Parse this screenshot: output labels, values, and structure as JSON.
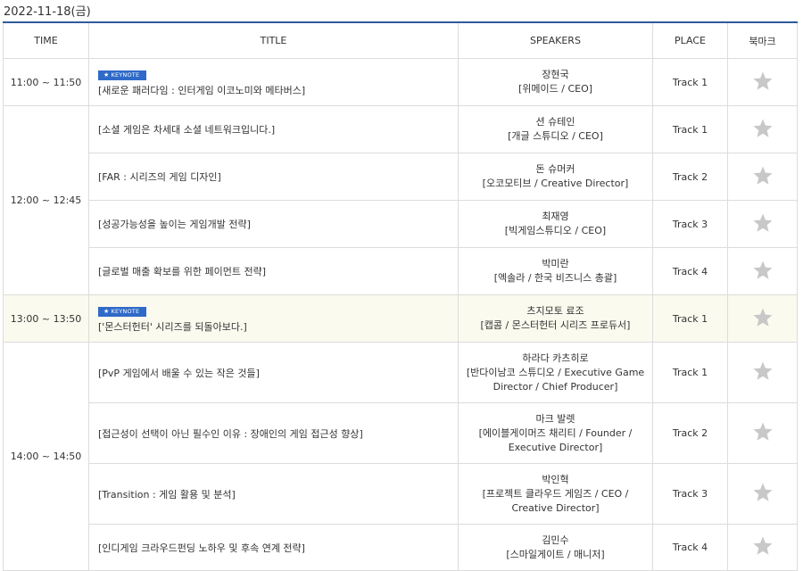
{
  "date": "2022-11-18(금)",
  "headers": {
    "time": "TIME",
    "title": "TITLE",
    "speakers": "SPEAKERS",
    "place": "PLACE",
    "bookmark": "북마크"
  },
  "keyword": "KEYNOTE",
  "colors": {
    "accent": "#2e5a9c",
    "keynote_badge": "#2f6ac8",
    "star": "#c8c8c8",
    "highlight_row": "#fbfaee"
  },
  "sessions": [
    {
      "time": "11:00 ~ 11:50",
      "title": "[새로운 패러다임 : 인터게임 이코노미와 메타버스]",
      "speaker": "장현국",
      "affiliation": "[위메이드 / CEO]",
      "place": "Track 1",
      "keynote": true
    },
    {
      "time": "12:00 ~ 12:45",
      "title": "[소셜 게임은 차세대 소셜 네트워크입니다.]",
      "speaker": "션 슈테인",
      "affiliation": "[개글 스튜디오 / CEO]",
      "place": "Track 1"
    },
    {
      "title": "[FAR : 시리즈의 게임 디자인]",
      "speaker": "돈 슈머커",
      "affiliation": "[오코모티브 / Creative Director]",
      "place": "Track 2"
    },
    {
      "title": "[성공가능성을 높이는 게임개발 전략]",
      "speaker": "최재영",
      "affiliation": "[빅게임스튜디오 / CEO]",
      "place": "Track 3"
    },
    {
      "title": "[글로벌 매출 확보를 위한 페이먼트 전략]",
      "speaker": "박미란",
      "affiliation": "[엑솔라 / 한국 비즈니스 총괄]",
      "place": "Track 4"
    },
    {
      "time": "13:00 ~ 13:50",
      "title": "['몬스터헌터' 시리즈를 되돌아보다.]",
      "speaker": "츠지모토 료조",
      "affiliation": "[캡콤 / 몬스터헌터 시리즈 프로듀서]",
      "place": "Track 1",
      "keynote": true
    },
    {
      "time": "14:00 ~ 14:50",
      "title": "[PvP 게임에서 배울 수 있는 작은 것들]",
      "speaker": "하라다 카츠히로",
      "affiliation": "[반다이남코 스튜디오 / Executive Game Director / Chief Producer]",
      "place": "Track 1"
    },
    {
      "title": "[접근성이 선택이 아닌 필수인 이유 : 장애인의 게임 접근성 향상]",
      "speaker": "마크 발렛",
      "affiliation": "[에이블게이머즈 채리티 / Founder / Executive Director]",
      "place": "Track 2"
    },
    {
      "title": "[Transition : 게임 활용 및 분석]",
      "speaker": "박인혁",
      "affiliation": "[프로젝트 클라우드 게임즈 / CEO / Creative Director]",
      "place": "Track 3"
    },
    {
      "title": "[인디게임 크라우드펀딩 노하우 및 후속 연계 전략]",
      "speaker": "김민수",
      "affiliation": "[스마일게이트 / 매니저]",
      "place": "Track 4"
    }
  ]
}
